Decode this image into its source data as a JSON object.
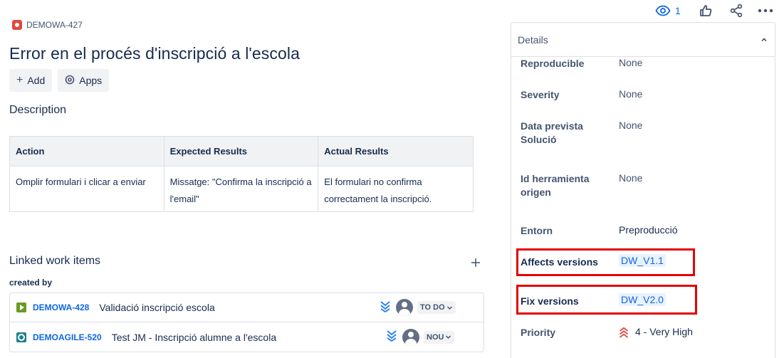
{
  "issue": {
    "key": "DEMOWA-427",
    "title": "Error en el procés d'inscripció a l'escola"
  },
  "actions": {
    "add_label": "Add",
    "apps_label": "Apps"
  },
  "description": {
    "heading": "Description",
    "table": {
      "headers": [
        "Action",
        "Expected Results",
        "Actual Results"
      ],
      "rows": [
        [
          "Omplir formulari i clicar a enviar",
          "Missatge: \"Confirma la inscripció a l'email\"",
          "El formulari no confirma correctament la inscripció."
        ]
      ]
    }
  },
  "linked": {
    "heading": "Linked work items",
    "group_label": "created by",
    "items": [
      {
        "type_icon": "story-icon",
        "key": "DEMOWA-428",
        "summary": "Validació inscripció escola",
        "status": "TO DO"
      },
      {
        "type_icon": "task-icon",
        "key": "DEMOAGILE-520",
        "summary": "Test JM - Inscripció alumne a l'escola",
        "status": "NOU"
      }
    ]
  },
  "toolbar": {
    "watchers_count": "1"
  },
  "details": {
    "title": "Details",
    "fields": {
      "reproducible": {
        "label": "Reproducible",
        "value": "None"
      },
      "severity": {
        "label": "Severity",
        "value": "None"
      },
      "data_prevista": {
        "label": "Data prevista Solució",
        "value": "None"
      },
      "id_herramienta": {
        "label": "Id herramienta origen",
        "value": "None"
      },
      "entorn": {
        "label": "Entorn",
        "value": "Preproducció"
      },
      "affects_versions": {
        "label": "Affects versions",
        "value": "DW_V1.1"
      },
      "fix_versions": {
        "label": "Fix versions",
        "value": "DW_V2.0"
      },
      "priority": {
        "label": "Priority",
        "value": "4 - Very High"
      }
    }
  },
  "colors": {
    "accent": "#0c66e4",
    "highlight_box": "#e30000",
    "bug": "#e2483d",
    "story": "#6a9a23",
    "task": "#1d7f8c"
  }
}
